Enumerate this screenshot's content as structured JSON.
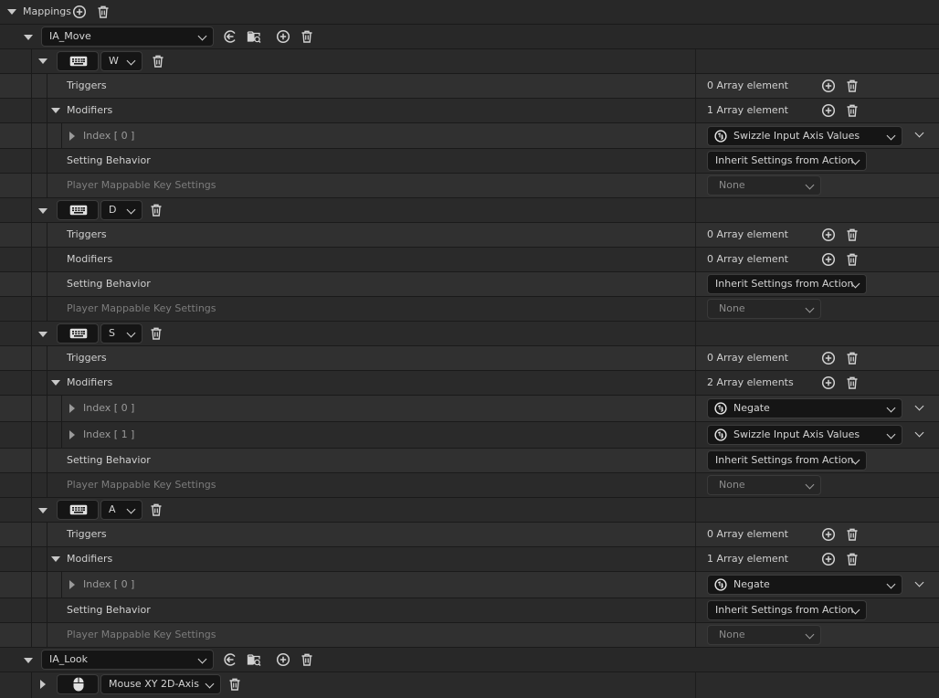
{
  "mappings": {
    "title": "Mappings"
  },
  "actions": [
    {
      "name": "IA_Move"
    },
    {
      "name": "IA_Look"
    }
  ],
  "keys": {
    "w": "W",
    "d": "D",
    "s": "S",
    "a": "A",
    "mouse": "Mouse XY 2D-Axis"
  },
  "labels": {
    "triggers": "Triggers",
    "modifiers": "Modifiers",
    "setting_behavior": "Setting Behavior",
    "player_mappable": "Player Mappable Key Settings",
    "index0": "Index [ 0 ]",
    "index1": "Index [ 1 ]"
  },
  "values": {
    "zero_elements": "0 Array element",
    "one_element": "1 Array element",
    "two_elements": "2 Array elements",
    "inherit": "Inherit Settings from Action",
    "none": "None",
    "swizzle": "Swizzle Input Axis Values",
    "negate": "Negate"
  },
  "icons": {
    "add": "plus-circle-icon",
    "delete": "trash-icon",
    "browse": "arrow-left-circle-icon",
    "find": "folder-search-icon",
    "keyboard": "keyboard-icon",
    "mouse": "mouse-icon",
    "ue": "unreal-logo-icon"
  },
  "colors": {
    "background": "#242424",
    "row": "#2a2a2a",
    "field": "#151515",
    "text": "#d0d0d0",
    "dim_text": "#7c7c7c"
  }
}
